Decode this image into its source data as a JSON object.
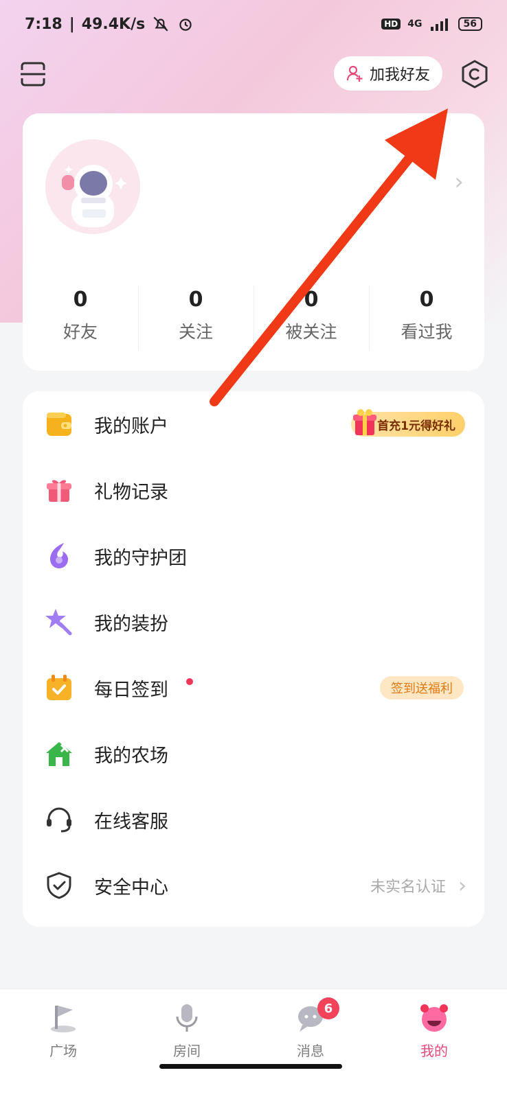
{
  "status_bar": {
    "time": "7:18",
    "network_speed": "49.4K/s",
    "hd": "HD",
    "network_type": "4G",
    "battery": "56"
  },
  "topbar": {
    "add_friend_label": "加我好友",
    "icons": [
      "scan-icon",
      "settings-icon",
      "add-friend-icon"
    ]
  },
  "profile": {
    "stats": [
      {
        "value": "0",
        "label": "好友"
      },
      {
        "value": "0",
        "label": "关注"
      },
      {
        "value": "0",
        "label": "被关注"
      },
      {
        "value": "0",
        "label": "看过我"
      }
    ]
  },
  "menu": {
    "items": [
      {
        "label": "我的账户",
        "badge": "首充1元得好礼",
        "icon": "wallet-icon"
      },
      {
        "label": "礼物记录",
        "icon": "gift-icon"
      },
      {
        "label": "我的守护团",
        "icon": "flame-icon"
      },
      {
        "label": "我的装扮",
        "icon": "star-wand-icon"
      },
      {
        "label": "每日签到",
        "badge": "签到送福利",
        "icon": "calendar-check-icon"
      },
      {
        "label": "我的农场",
        "icon": "farm-house-icon"
      },
      {
        "label": "在线客服",
        "icon": "headset-icon"
      },
      {
        "label": "安全中心",
        "right_text": "未实名认证",
        "icon": "shield-check-icon"
      }
    ]
  },
  "bottom_nav": {
    "tabs": [
      {
        "label": "广场",
        "icon": "flag-icon"
      },
      {
        "label": "房间",
        "icon": "microphone-icon"
      },
      {
        "label": "消息",
        "icon": "chat-icon",
        "badge": "6"
      },
      {
        "label": "我的",
        "icon": "profile-face-icon",
        "active": true
      }
    ]
  },
  "colors": {
    "accent": "#e84a78",
    "badge_red": "#f2435a",
    "annotation_arrow": "#f03a17"
  }
}
